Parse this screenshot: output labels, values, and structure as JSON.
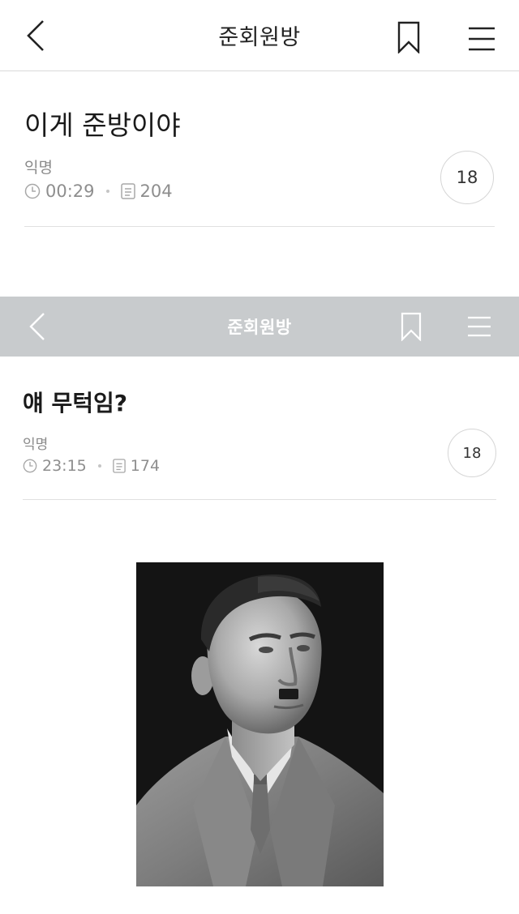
{
  "screenshot1": {
    "header": {
      "title": "준회원방",
      "back_icon": "chevron-left-icon",
      "bookmark_icon": "bookmark-icon",
      "menu_icon": "hamburger-menu-icon"
    },
    "post": {
      "title": "이게 준방이야",
      "author": "익명",
      "time": "00:29",
      "views": "204",
      "comment_count": "18"
    }
  },
  "screenshot2": {
    "header": {
      "title": "준회원방",
      "back_icon": "chevron-left-icon",
      "bookmark_icon": "bookmark-icon",
      "menu_icon": "hamburger-menu-icon",
      "bar_color": "#c8cbcd"
    },
    "post": {
      "title": "얘 무턱임?",
      "author": "익명",
      "time": "23:15",
      "views": "174",
      "comment_count": "18"
    },
    "image": {
      "description_icon": "portrait-photo"
    }
  }
}
